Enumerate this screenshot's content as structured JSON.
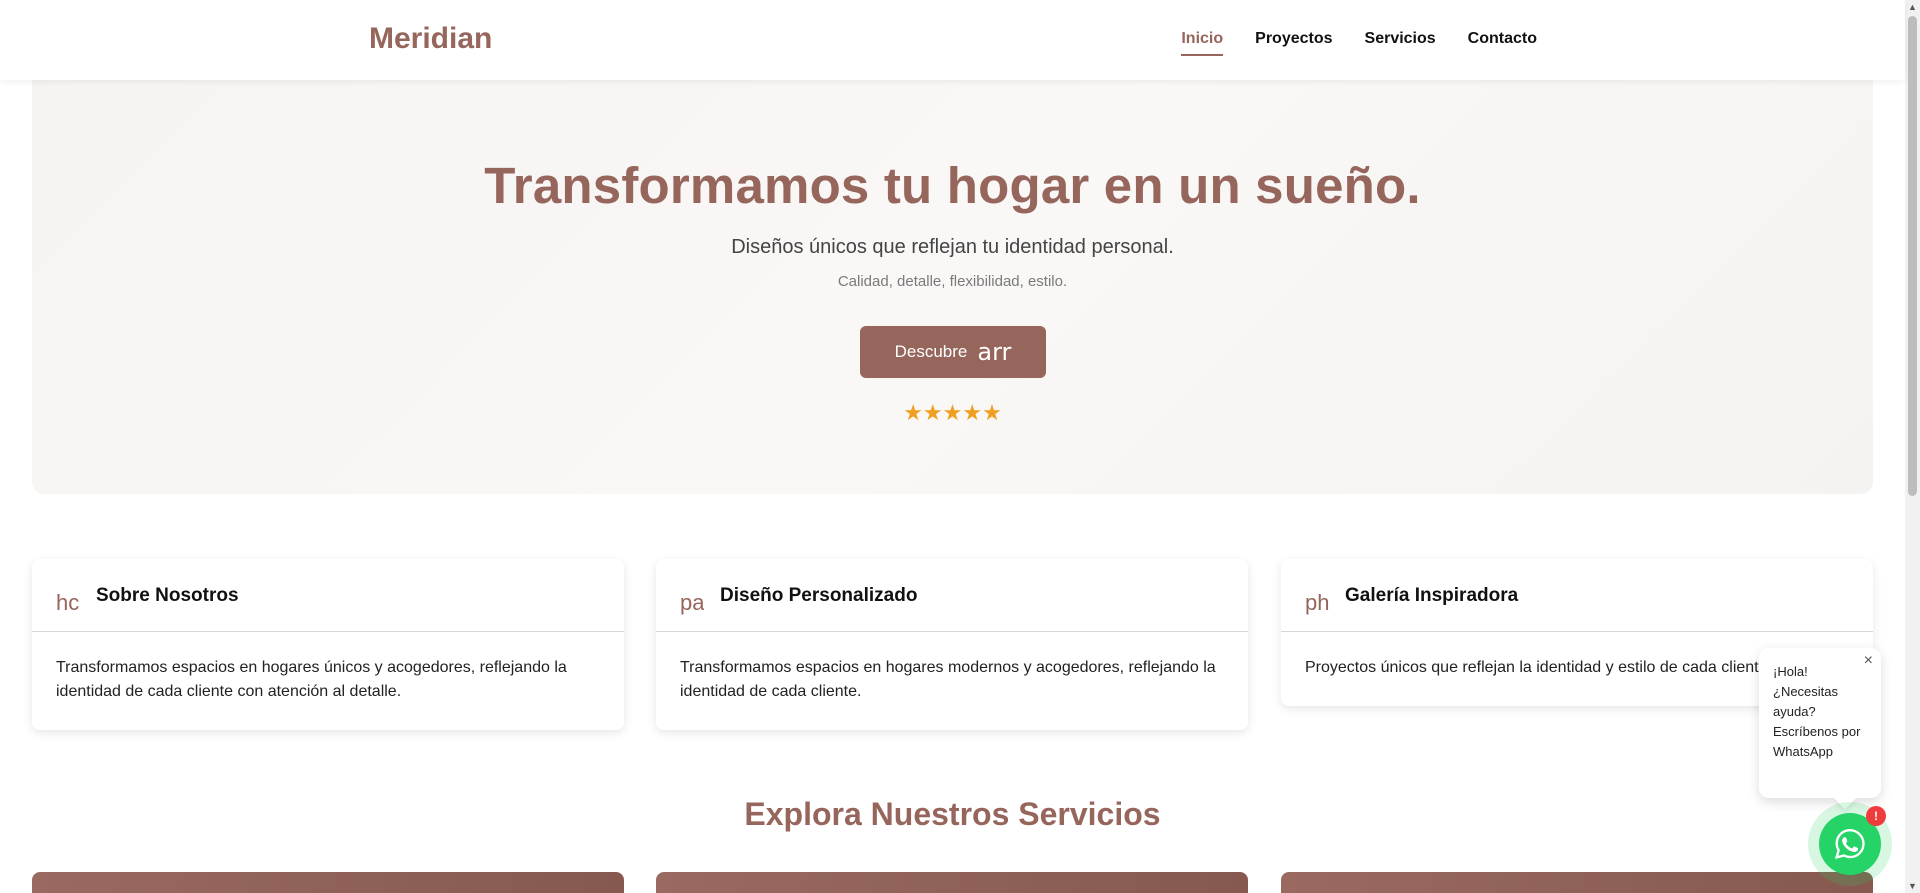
{
  "header": {
    "logo": "Meridian",
    "nav": [
      {
        "label": "Inicio",
        "active": true
      },
      {
        "label": "Proyectos",
        "active": false
      },
      {
        "label": "Servicios",
        "active": false
      },
      {
        "label": "Contacto",
        "active": false
      }
    ]
  },
  "hero": {
    "title": "Transformamos tu hogar en un sueño.",
    "subtitle": "Diseños únicos que reflejan tu identidad personal.",
    "tagline": "Calidad, detalle, flexibilidad, estilo.",
    "cta_label": "Descubre",
    "cta_icon_text": "arr",
    "stars": "★★★★★",
    "rating": 5
  },
  "cards": [
    {
      "icon_text": "hc",
      "icon": "home-icon",
      "title": "Sobre Nosotros",
      "body": "Transformamos espacios en hogares únicos y acogedores, reflejando la identidad de cada cliente con atención al detalle."
    },
    {
      "icon_text": "pa",
      "icon": "palette-icon",
      "title": "Diseño Personalizado",
      "body": "Transformamos espacios en hogares modernos y acogedores, reflejando la identidad de cada cliente."
    },
    {
      "icon_text": "ph",
      "icon": "photo-icon",
      "title": "Galería Inspiradora",
      "body": "Proyectos únicos que reflejan la identidad y estilo de cada cliente."
    }
  ],
  "services": {
    "title": "Explora Nuestros Servicios"
  },
  "whatsapp": {
    "message": "¡Hola! ¿Necesitas ayuda? Escríbenos por WhatsApp",
    "close": "×",
    "badge": "!"
  },
  "colors": {
    "brand": "#96655b",
    "star": "#f0a020",
    "whatsapp": "#25d366",
    "badge": "#ef3b3b"
  }
}
